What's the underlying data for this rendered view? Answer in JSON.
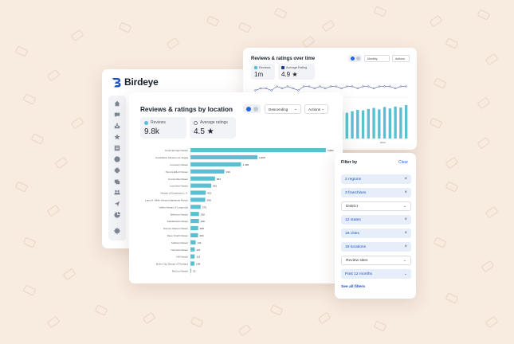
{
  "brand": {
    "name": "Birdeye"
  },
  "colors": {
    "accent": "#2563eb",
    "bar": "#5bbfd1",
    "background": "#f8ebe0"
  },
  "sidebar": {
    "icons": [
      "home-icon",
      "chat-icon",
      "inbox-icon",
      "star-icon",
      "list-icon",
      "clock-icon",
      "puzzle-icon",
      "gallery-icon",
      "users-icon",
      "send-icon",
      "pie-icon",
      "gear-icon"
    ]
  },
  "time_card": {
    "title": "Reviews & ratings over time",
    "period_select": "Monthly",
    "actions_select": "Actions",
    "stats": [
      {
        "label": "Reviews",
        "value": "1m",
        "color": "#5bbfd1"
      },
      {
        "label": "Average Rating",
        "value": "4.9 ★",
        "color": "#1f3a93"
      }
    ]
  },
  "location_card": {
    "title": "Reviews & ratings by location",
    "sort_select": "Descending",
    "actions_select": "Actions",
    "stats": [
      {
        "label": "Reviews",
        "value": "9.8k",
        "color": "#5bbfd1"
      },
      {
        "label": "Average ratings",
        "value": "4.5 ★",
        "color": "#ffffff"
      }
    ]
  },
  "filter": {
    "title": "Filter by",
    "clear_label": "Clear",
    "rows": [
      {
        "label": "2 regions",
        "state": "selected"
      },
      {
        "label": "3 franchises",
        "state": "selected"
      },
      {
        "label": "District",
        "state": "dropdown"
      },
      {
        "label": "12 states",
        "state": "selected"
      },
      {
        "label": "18 cities",
        "state": "selected"
      },
      {
        "label": "19 locations",
        "state": "selected"
      },
      {
        "label": "Review sites",
        "state": "dropdown"
      },
      {
        "label": "Past 12 months",
        "state": "selected-dropdown"
      }
    ],
    "see_all_label": "See all filters"
  },
  "chart_data": [
    {
      "type": "bar",
      "orientation": "horizontal",
      "title": "Reviews & ratings by location",
      "categories": [
        "Coral Springs Nissan",
        "AutoNation Nissan Las Vegas",
        "Courtesy Nissan",
        "Hennis Elliott Nissan",
        "Cornerville Nissan",
        "Incentive Nissan",
        "Nissan of Downtown L.A.",
        "Larry H. Miller Nissan Highlands Ranch",
        "Valley Nissan of Longmont",
        "Bellevue Nissan",
        "Saddleback Nissan",
        "Sonnen Motors Nissan",
        "Dave Smith Nissan",
        "Sullivan Nissan",
        "Hemtick Nissan",
        "Hill Nissan",
        "Bob's City Nissan of Portland",
        "McCoo Nissan"
      ],
      "values": [
        3654,
        1806,
        1366,
        916,
        663,
        561,
        412,
        398,
        275,
        230,
        228,
        208,
        204,
        141,
        116,
        113,
        108,
        21
      ],
      "value_labels": [
        "3,654",
        "1,806",
        "1,366",
        "916",
        "663",
        "561",
        "412",
        "398",
        "275",
        "230",
        "228",
        "208",
        "204",
        "141",
        "116",
        "113",
        "108",
        "21"
      ],
      "xlim": [
        0,
        3700
      ]
    },
    {
      "type": "bar",
      "title": "Reviews & ratings over time",
      "categories": [
        "2022",
        "2023",
        "2024"
      ],
      "values": [
        35,
        38,
        42,
        40,
        44,
        47,
        45,
        50,
        46,
        48,
        52,
        55,
        51,
        49,
        53,
        56,
        58,
        54,
        57,
        60,
        59,
        62,
        64,
        61,
        66,
        63,
        67,
        65,
        70
      ],
      "rating_line": [
        4.7,
        4.8,
        4.8,
        4.7,
        4.9,
        4.8,
        4.9,
        4.8,
        4.7,
        4.9,
        4.9,
        4.8,
        4.9,
        4.8,
        4.9,
        4.9,
        4.8,
        4.9,
        4.9,
        4.8,
        4.9,
        4.9,
        4.8,
        4.9,
        4.9,
        4.9,
        4.8,
        4.9,
        4.9
      ]
    }
  ]
}
